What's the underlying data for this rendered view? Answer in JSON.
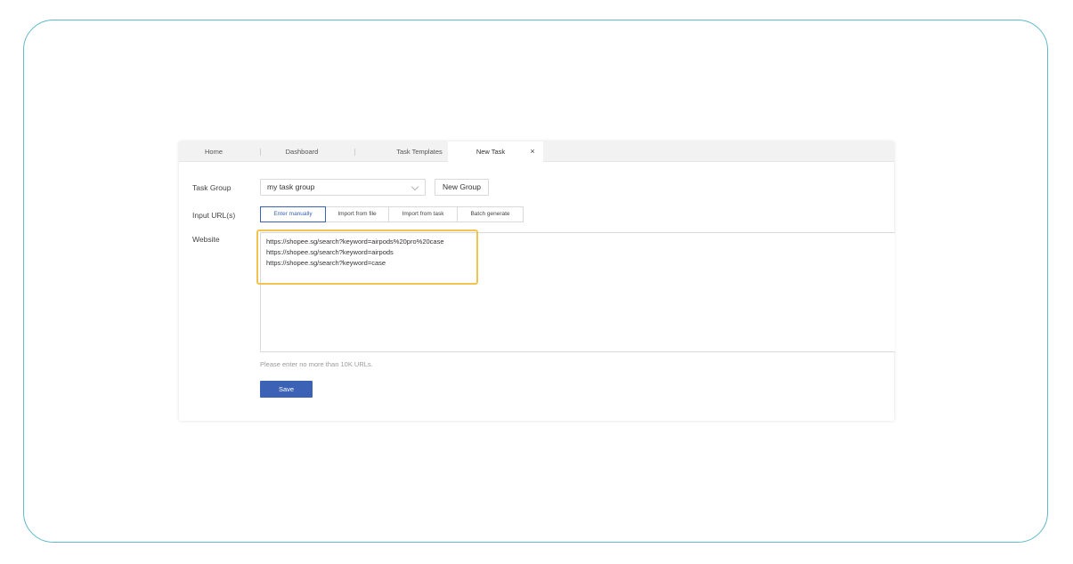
{
  "tabs": [
    {
      "label": "Home"
    },
    {
      "label": "Dashboard"
    },
    {
      "label": "Task Templates"
    },
    {
      "label": "New Task",
      "active": true
    }
  ],
  "tab_close_glyph": "×",
  "form": {
    "task_group_label": "Task Group",
    "task_group_value": "my task group",
    "new_group_label": "New Group",
    "input_urls_label": "Input URL(s)",
    "input_modes": [
      "Enter manually",
      "Import from file",
      "Import from task",
      "Batch generate"
    ],
    "active_mode": "Enter manually",
    "website_label": "Website",
    "urls": [
      "https://shopee.sg/search?keyword=airpods%20pro%20case",
      "https://shopee.sg/search?keyword=airpods",
      "https://shopee.sg/search?keyword=case"
    ],
    "hint": "Please enter no more than 10K URLs.",
    "save_label": "Save"
  },
  "colors": {
    "accent": "#3b62b5",
    "highlight": "#f2c34e",
    "frame_border": "#5fb9c6"
  },
  "icons": {
    "dropdown": "chevron-down-icon",
    "close_tab": "close-icon"
  }
}
